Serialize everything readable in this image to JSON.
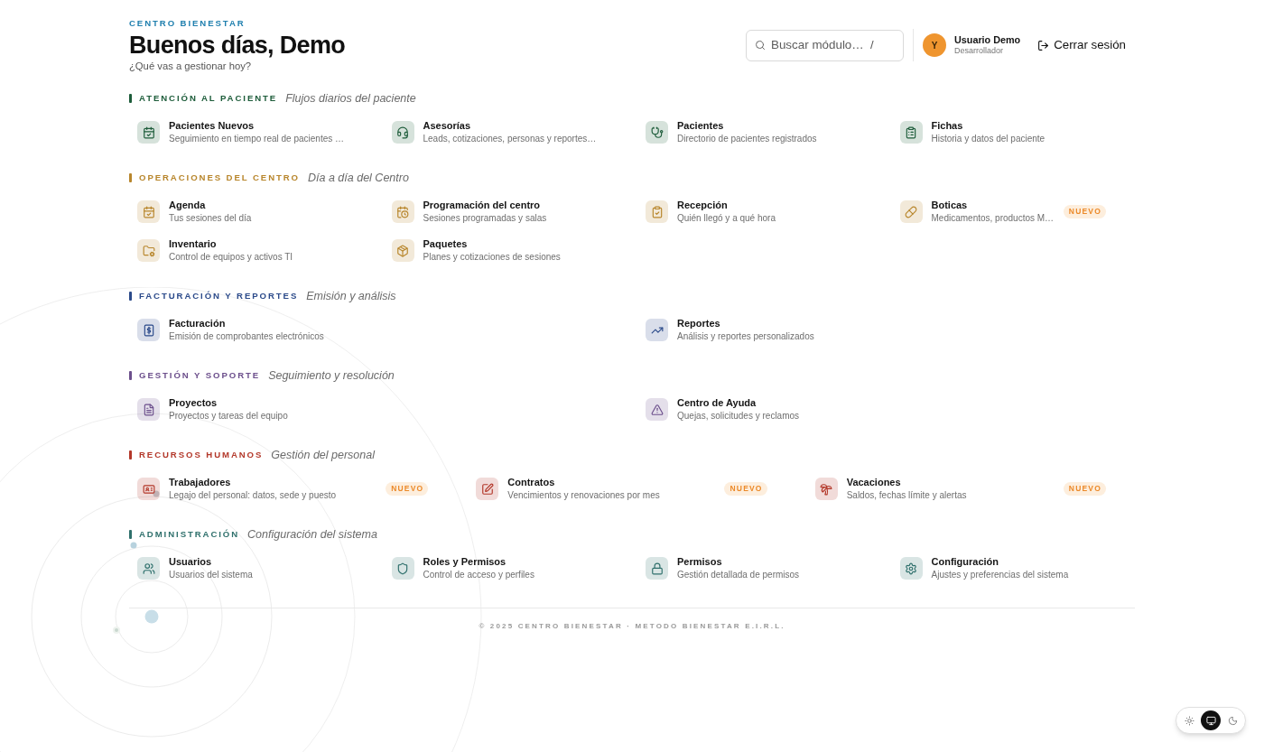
{
  "header": {
    "brand": "CENTRO BIENESTAR",
    "greeting": "Buenos días, Demo",
    "subtitle": "¿Qué vas a gestionar hoy?"
  },
  "search": {
    "placeholder": "Buscar módulo…",
    "shortcut": "/"
  },
  "user": {
    "initial": "Y",
    "name": "Usuario Demo",
    "role": "Desarrollador"
  },
  "logout": {
    "label": "Cerrar sesión"
  },
  "sections": [
    {
      "title": "ATENCIÓN AL PACIENTE",
      "subtitle": "Flujos diarios del paciente",
      "color": "#1d5c3a",
      "items": [
        {
          "title": "Pacientes Nuevos",
          "description": "Seguimiento en tiempo real de pacientes …"
        },
        {
          "title": "Asesorías",
          "description": "Leads, cotizaciones, personas y reportes…"
        },
        {
          "title": "Pacientes",
          "description": "Directorio de pacientes registrados"
        },
        {
          "title": "Fichas",
          "description": "Historia y datos del paciente"
        }
      ]
    },
    {
      "title": "OPERACIONES DEL CENTRO",
      "subtitle": "Día a día del Centro",
      "color": "#b8862c",
      "items": [
        {
          "title": "Agenda",
          "description": "Tus sesiones del día"
        },
        {
          "title": "Programación del centro",
          "description": "Sesiones programadas y salas"
        },
        {
          "title": "Recepción",
          "description": "Quién llegó y a qué hora"
        },
        {
          "title": "Boticas",
          "description": "Medicamentos, productos M…",
          "badge": "NUEVO"
        },
        {
          "title": "Inventario",
          "description": "Control de equipos y activos TI"
        },
        {
          "title": "Paquetes",
          "description": "Planes y cotizaciones de sesiones"
        }
      ]
    },
    {
      "title": "FACTURACIÓN Y REPORTES",
      "subtitle": "Emisión y análisis",
      "color": "#2b4a8a",
      "items": [
        {
          "title": "Facturación",
          "description": "Emisión de comprobantes electrónicos"
        },
        {
          "title": "Reportes",
          "description": "Análisis y reportes personalizados"
        }
      ]
    },
    {
      "title": "GESTIÓN Y SOPORTE",
      "subtitle": "Seguimiento y resolución",
      "color": "#6c4f8c",
      "items": [
        {
          "title": "Proyectos",
          "description": "Proyectos y tareas del equipo"
        },
        {
          "title": "Centro de Ayuda",
          "description": "Quejas, solicitudes y reclamos"
        }
      ]
    },
    {
      "title": "RECURSOS HUMANOS",
      "subtitle": "Gestión del personal",
      "color": "#b3382a",
      "items": [
        {
          "title": "Trabajadores",
          "description": "Legajo del personal: datos, sede y puesto",
          "badge": "NUEVO"
        },
        {
          "title": "Contratos",
          "description": "Vencimientos y renovaciones por mes",
          "badge": "NUEVO"
        },
        {
          "title": "Vacaciones",
          "description": "Saldos, fechas límite y alertas",
          "badge": "NUEVO"
        }
      ]
    },
    {
      "title": "ADMINISTRACIÓN",
      "subtitle": "Configuración del sistema",
      "color": "#2f706c",
      "items": [
        {
          "title": "Usuarios",
          "description": "Usuarios del sistema"
        },
        {
          "title": "Roles y Permisos",
          "description": "Control de acceso y perfiles"
        },
        {
          "title": "Permisos",
          "description": "Gestión detallada de permisos"
        },
        {
          "title": "Configuración",
          "description": "Ajustes y preferencias del sistema"
        }
      ]
    }
  ],
  "footer": "© 2025 CENTRO BIENESTAR · METODO BIENESTAR E.I.R.L.",
  "theme_toggle": [
    {
      "kind": "light",
      "selected": false
    },
    {
      "kind": "system",
      "selected": true
    },
    {
      "kind": "dark",
      "selected": false
    }
  ]
}
